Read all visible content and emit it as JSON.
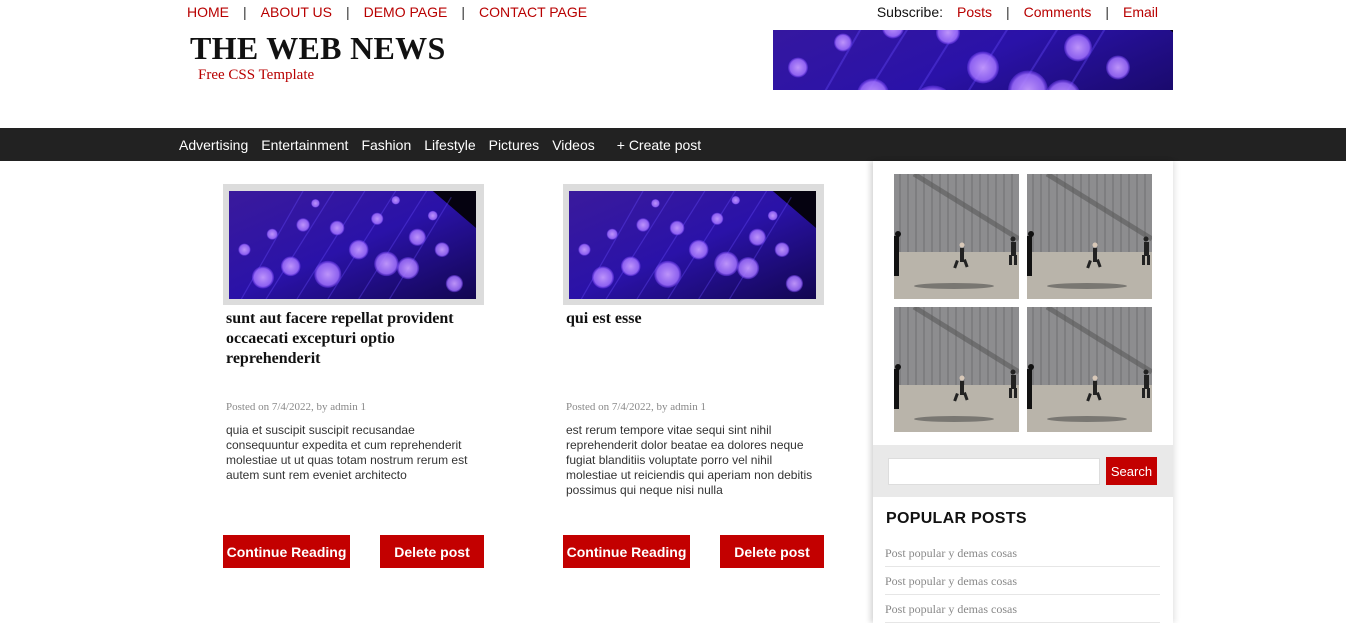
{
  "top_nav": {
    "links": [
      {
        "label": "HOME"
      },
      {
        "label": "ABOUT US"
      },
      {
        "label": "DEMO PAGE"
      },
      {
        "label": "CONTACT PAGE"
      }
    ],
    "separator": "|"
  },
  "subscribe": {
    "label": "Subscribe:",
    "links": [
      {
        "label": "Posts"
      },
      {
        "label": "Comments"
      },
      {
        "label": "Email"
      }
    ]
  },
  "site": {
    "title": "THE WEB NEWS",
    "subtitle": "Free CSS Template"
  },
  "categories": {
    "items": [
      {
        "label": "Advertising"
      },
      {
        "label": "Entertainment"
      },
      {
        "label": "Fashion"
      },
      {
        "label": "Lifestyle"
      },
      {
        "label": "Pictures"
      },
      {
        "label": "Videos"
      }
    ],
    "create_label": "+ Create post"
  },
  "posts": [
    {
      "title": "sunt aut facere repellat provident occaecati excepturi optio reprehenderit",
      "meta": "Posted on 7/4/2022, by admin 1",
      "excerpt": "quia et suscipit suscipit recusandae consequuntur expedita et cum reprehenderit molestiae ut ut quas totam nostrum rerum est autem sunt rem eveniet architecto",
      "read_label": "Continue Reading",
      "delete_label": "Delete post"
    },
    {
      "title": "qui est esse",
      "meta": "Posted on 7/4/2022, by admin 1",
      "excerpt": "est rerum tempore vitae sequi sint nihil reprehenderit dolor beatae ea dolores neque fugiat blanditiis voluptate porro vel nihil molestiae ut reiciendis qui aperiam non debitis possimus qui neque nisi nulla",
      "read_label": "Continue Reading",
      "delete_label": "Delete post"
    }
  ],
  "sidebar": {
    "search_button": "Search",
    "search_value": "",
    "popular_title": "POPULAR POSTS",
    "popular_items": [
      "Post popular y demas cosas",
      "Post popular y demas cosas",
      "Post popular y demas cosas"
    ]
  },
  "colors": {
    "accent": "#c30000",
    "nav_bar": "#222222",
    "link": "#b80000"
  }
}
